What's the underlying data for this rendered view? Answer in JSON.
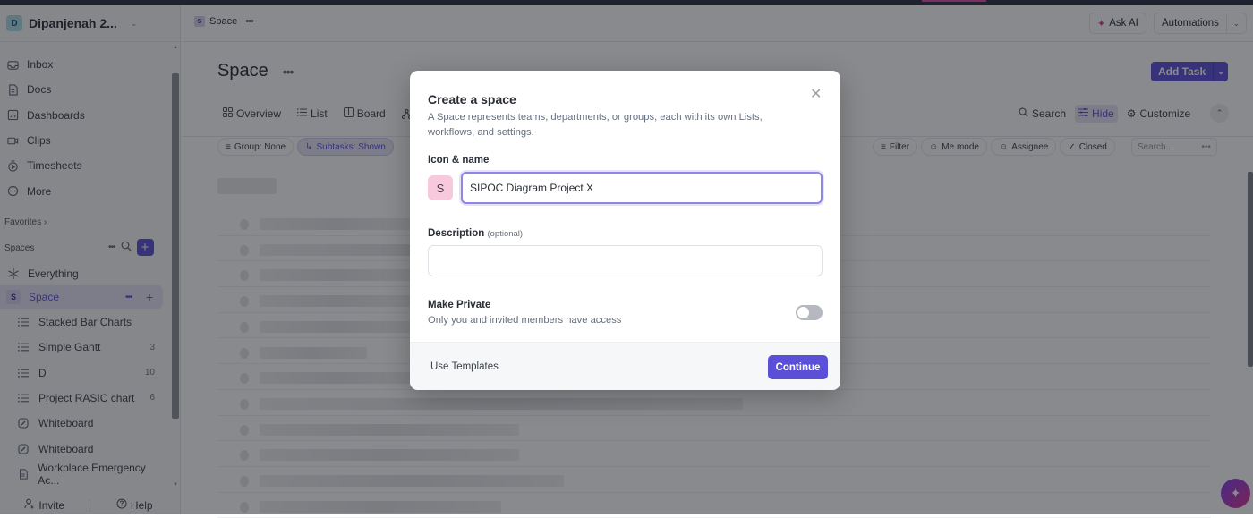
{
  "workspace": {
    "initial": "D",
    "name": "Dipanjenah 2..."
  },
  "sidebar": {
    "nav": [
      {
        "label": "Inbox",
        "icon": "inbox-icon"
      },
      {
        "label": "Docs",
        "icon": "doc-icon"
      },
      {
        "label": "Dashboards",
        "icon": "dashboard-icon"
      },
      {
        "label": "Clips",
        "icon": "video-icon"
      },
      {
        "label": "Timesheets",
        "icon": "timer-icon"
      },
      {
        "label": "More",
        "icon": "more-icon"
      }
    ],
    "favorites_label": "Favorites",
    "spaces_label": "Spaces",
    "everything_label": "Everything",
    "space": {
      "badge": "S",
      "label": "Space"
    },
    "items": [
      {
        "label": "Stacked Bar Charts",
        "icon": "list-icon",
        "count": ""
      },
      {
        "label": "Simple Gantt",
        "icon": "list-icon",
        "count": "3"
      },
      {
        "label": "D",
        "icon": "list-icon",
        "count": "10"
      },
      {
        "label": "Project RASIC chart",
        "icon": "list-icon",
        "count": "6"
      },
      {
        "label": "Whiteboard",
        "icon": "whiteboard-icon",
        "count": ""
      },
      {
        "label": "Whiteboard",
        "icon": "whiteboard-icon",
        "count": ""
      },
      {
        "label": "Workplace Emergency Ac...",
        "icon": "doc-icon",
        "count": ""
      }
    ],
    "invite_label": "Invite",
    "help_label": "Help"
  },
  "header": {
    "breadcrumb_badge": "S",
    "breadcrumb": "Space",
    "ask_ai": "Ask AI",
    "automations": "Automations"
  },
  "page": {
    "title": "Space",
    "add_task": "Add Task",
    "views": [
      "Overview",
      "List",
      "Board"
    ],
    "tools": {
      "search": "Search",
      "hide": "Hide",
      "customize": "Customize"
    },
    "chips_left": [
      "Group: None",
      "Subtasks: Shown"
    ],
    "chips_right": [
      "Filter",
      "Me mode",
      "Assignee",
      "Closed"
    ],
    "search_placeholder": "Search..."
  },
  "modal": {
    "title": "Create a space",
    "description": "A Space represents teams, departments, or groups, each with its own Lists, workflows, and settings.",
    "icon_name_label": "Icon & name",
    "icon_letter": "S",
    "name_value": "SIPOC Diagram Project X",
    "description_label": "Description",
    "description_optional": "(optional)",
    "description_value": "",
    "private_title": "Make Private",
    "private_subtitle": "Only you and invited members have access",
    "private_enabled": false,
    "use_templates": "Use Templates",
    "continue": "Continue"
  },
  "colors": {
    "accent": "#5b4fd8",
    "icon_bg": "#f8c9dc"
  }
}
